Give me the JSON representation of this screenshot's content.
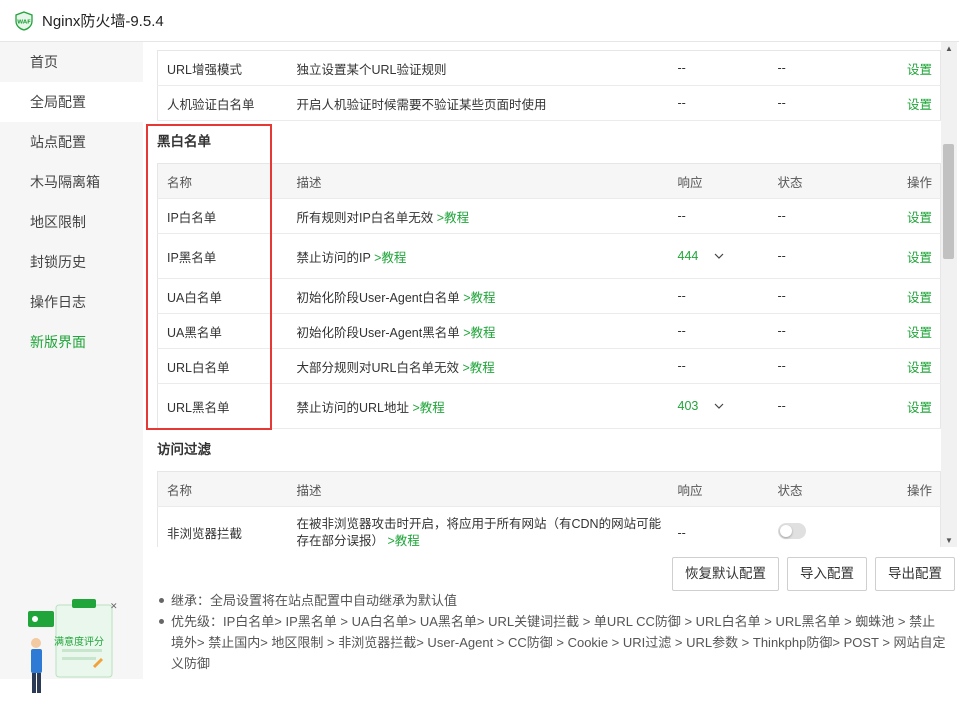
{
  "app": {
    "title": "Nginx防火墙-9.5.4",
    "logo_text": "WAF",
    "accent": "#20a53a"
  },
  "sidebar": {
    "items": [
      {
        "label": "首页"
      },
      {
        "label": "全局配置"
      },
      {
        "label": "站点配置"
      },
      {
        "label": "木马隔离箱"
      },
      {
        "label": "地区限制"
      },
      {
        "label": "封锁历史"
      },
      {
        "label": "操作日志"
      },
      {
        "label": "新版界面"
      }
    ]
  },
  "top_rows": [
    {
      "name": "URL增强模式",
      "desc": "独立设置某个URL验证规则",
      "resp": "--",
      "status": "--",
      "op": "设置"
    },
    {
      "name": "人机验证白名单",
      "desc": "开启人机验证时候需要不验证某些页面时使用",
      "resp": "--",
      "status": "--",
      "op": "设置"
    }
  ],
  "blackwhite": {
    "title": "黑白名单",
    "headers": {
      "name": "名称",
      "desc": "描述",
      "resp": "响应",
      "status": "状态",
      "op": "操作"
    },
    "rows": [
      {
        "name": "IP白名单",
        "desc": "所有规则对IP白名单无效",
        "link": ">教程",
        "resp": "--",
        "status": "--",
        "op": "设置"
      },
      {
        "name": "IP黑名单",
        "desc": "禁止访问的IP",
        "link": ">教程",
        "resp": "444",
        "status": "--",
        "op": "设置"
      },
      {
        "name": "UA白名单",
        "desc": "初始化阶段User-Agent白名单",
        "link": ">教程",
        "resp": "--",
        "status": "--",
        "op": "设置"
      },
      {
        "name": "UA黑名单",
        "desc": "初始化阶段User-Agent黑名单",
        "link": ">教程",
        "resp": "--",
        "status": "--",
        "op": "设置"
      },
      {
        "name": "URL白名单",
        "desc": "大部分规则对URL白名单无效",
        "link": ">教程",
        "resp": "--",
        "status": "--",
        "op": "设置"
      },
      {
        "name": "URL黑名单",
        "desc": "禁止访问的URL地址",
        "link": ">教程",
        "resp": "403",
        "status": "--",
        "op": "设置"
      }
    ]
  },
  "access_filter": {
    "title": "访问过滤",
    "headers": {
      "name": "名称",
      "desc": "描述",
      "resp": "响应",
      "status": "状态",
      "op": "操作"
    },
    "rows": [
      {
        "name": "非浏览器拦截",
        "desc": "在被非浏览器攻击时开启，将应用于所有网站（有CDN的网站可能存在部分误报）",
        "link": ">教程",
        "resp": "--",
        "status_toggle": false
      }
    ]
  },
  "buttons": {
    "restore": "恢复默认配置",
    "import": "导入配置",
    "export": "导出配置"
  },
  "notes": {
    "inherit": "继承：全局设置将在站点配置中自动继承为默认值",
    "priority": "优先级：IP白名单> IP黑名单 > UA白名单> UA黑名单> URL关键词拦截 > 单URL CC防御 > URL白名单 > URL黑名单 > 蜘蛛池 > 禁止境外> 禁止国内> 地区限制 > 非浏览器拦截> User-Agent > CC防御 > Cookie > URI过滤 > URL参数 > Thinkphp防御> POST > 网站自定义防御"
  },
  "rating": {
    "label": "满意度评分"
  }
}
